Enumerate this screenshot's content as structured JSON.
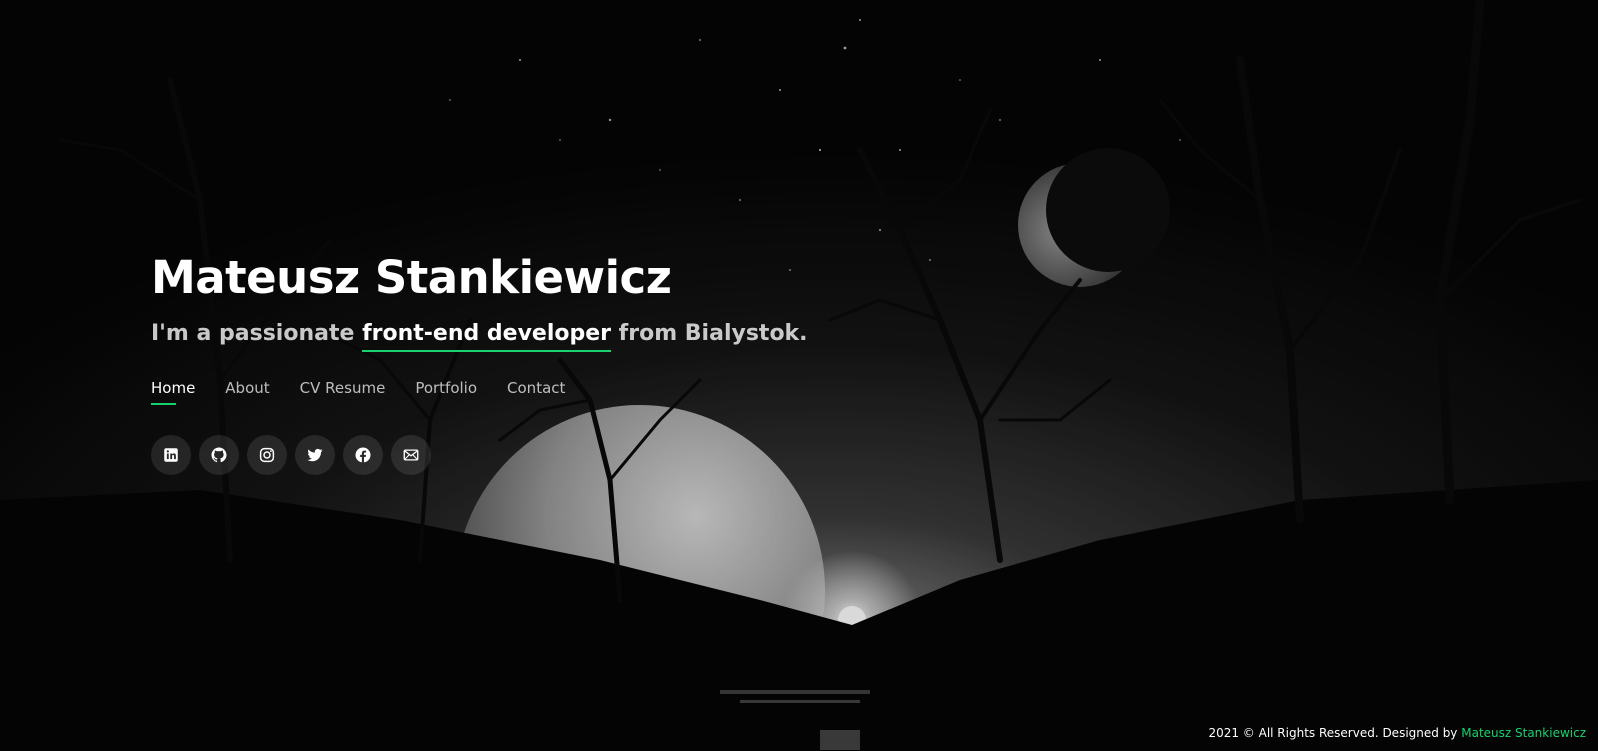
{
  "header": {
    "name": "Mateusz Stankiewicz",
    "tagline_prefix": "I'm a passionate ",
    "tagline_highlight": "front-end developer",
    "tagline_suffix": " from Bialystok."
  },
  "nav": {
    "items": [
      {
        "label": "Home",
        "active": true
      },
      {
        "label": "About",
        "active": false
      },
      {
        "label": "CV Resume",
        "active": false
      },
      {
        "label": "Portfolio",
        "active": false
      },
      {
        "label": "Contact",
        "active": false
      }
    ]
  },
  "social": {
    "icons": [
      "linkedin-icon",
      "github-icon",
      "instagram-icon",
      "twitter-icon",
      "facebook-icon",
      "envelope-icon"
    ]
  },
  "footer": {
    "text": "2021 © All Rights Reserved. Designed by ",
    "author": "Mateusz Stankiewicz"
  },
  "colors": {
    "accent": "#18d26e",
    "background": "#000000",
    "text": "#ffffff"
  }
}
